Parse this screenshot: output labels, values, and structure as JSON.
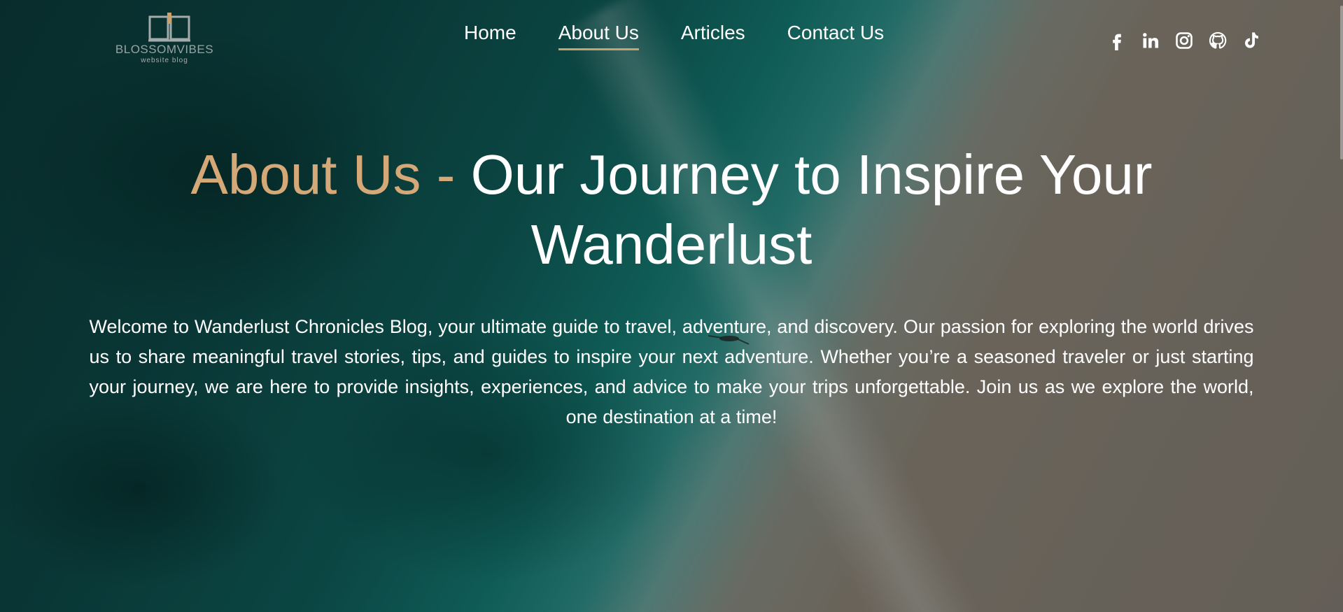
{
  "logo": {
    "name": "BLOSSOMVIBES",
    "tagline": "website blog"
  },
  "nav": {
    "items": [
      {
        "label": "Home",
        "active": false
      },
      {
        "label": "About Us",
        "active": true
      },
      {
        "label": "Articles",
        "active": false
      },
      {
        "label": "Contact Us",
        "active": false
      }
    ]
  },
  "social": [
    "facebook-icon",
    "linkedin-icon",
    "instagram-icon",
    "github-icon",
    "tiktok-icon"
  ],
  "hero": {
    "title_accent": "About Us - ",
    "title_main": "Our Journey to Inspire Your Wanderlust",
    "intro": "Welcome to Wanderlust Chronicles Blog, your ultimate guide to travel, adventure, and discovery. Our passion for exploring the world drives us to share meaningful travel stories, tips, and guides to inspire your next adventure. Whether you’re a seasoned traveler or just starting your journey, we are here to provide insights, experiences, and advice to make your trips unforgettable. Join us as we explore the world, one destination at a time!"
  },
  "colors": {
    "accent": "#d4a877",
    "nav_underline": "#c9a36e",
    "text": "#ffffff"
  }
}
